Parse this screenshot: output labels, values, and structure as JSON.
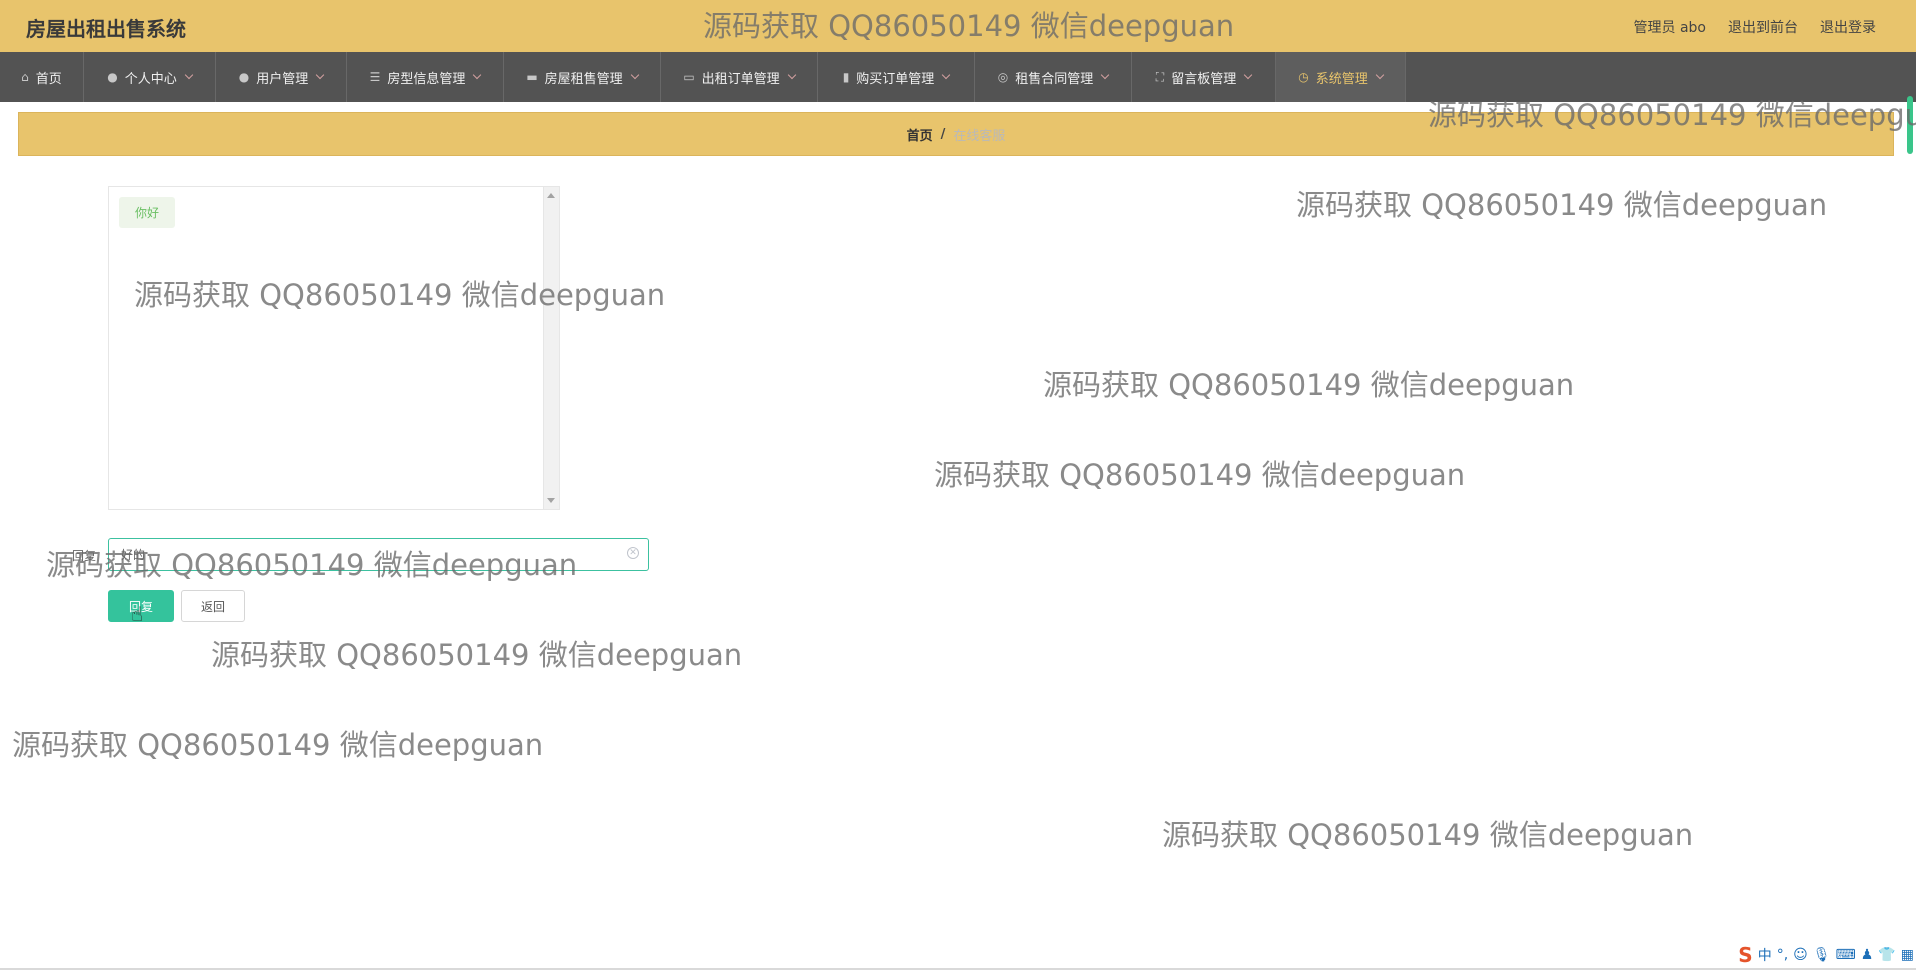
{
  "app": {
    "title": "房屋出租出售系统"
  },
  "header": {
    "admin_label": "管理员 abo",
    "links": [
      "退出到前台",
      "退出登录"
    ]
  },
  "nav": {
    "items": [
      {
        "label": "首页",
        "icon": "home-icon",
        "has_menu": false
      },
      {
        "label": "个人中心",
        "icon": "user-icon",
        "has_menu": true
      },
      {
        "label": "用户管理",
        "icon": "user-icon",
        "has_menu": true
      },
      {
        "label": "房型信息管理",
        "icon": "list-icon",
        "has_menu": true
      },
      {
        "label": "房屋租售管理",
        "icon": "chat-icon",
        "has_menu": true
      },
      {
        "label": "出租订单管理",
        "icon": "message-icon",
        "has_menu": true
      },
      {
        "label": "购买订单管理",
        "icon": "mic-icon",
        "has_menu": true
      },
      {
        "label": "租售合同管理",
        "icon": "compass-icon",
        "has_menu": true
      },
      {
        "label": "留言板管理",
        "icon": "fullscreen-icon",
        "has_menu": true
      },
      {
        "label": "系统管理",
        "icon": "clock-icon",
        "has_menu": true,
        "active": true
      }
    ]
  },
  "breadcrumb": {
    "home": "首页",
    "separator": "/",
    "current": "在线客服"
  },
  "chat": {
    "messages": [
      {
        "text": "你好",
        "from": "user"
      }
    ]
  },
  "reply": {
    "label": "回复",
    "value": "好的",
    "submit_label": "回复",
    "back_label": "返回"
  },
  "watermark_text": "源码获取 QQ86050149 微信deepguan",
  "tray": {
    "ime_label": "中"
  },
  "colors": {
    "header_bg": "#e8c46c",
    "nav_bg": "#535353",
    "active_nav_text": "#e8c46c",
    "primary_button": "#34c39c",
    "chat_bubble_text": "#6abf63"
  }
}
